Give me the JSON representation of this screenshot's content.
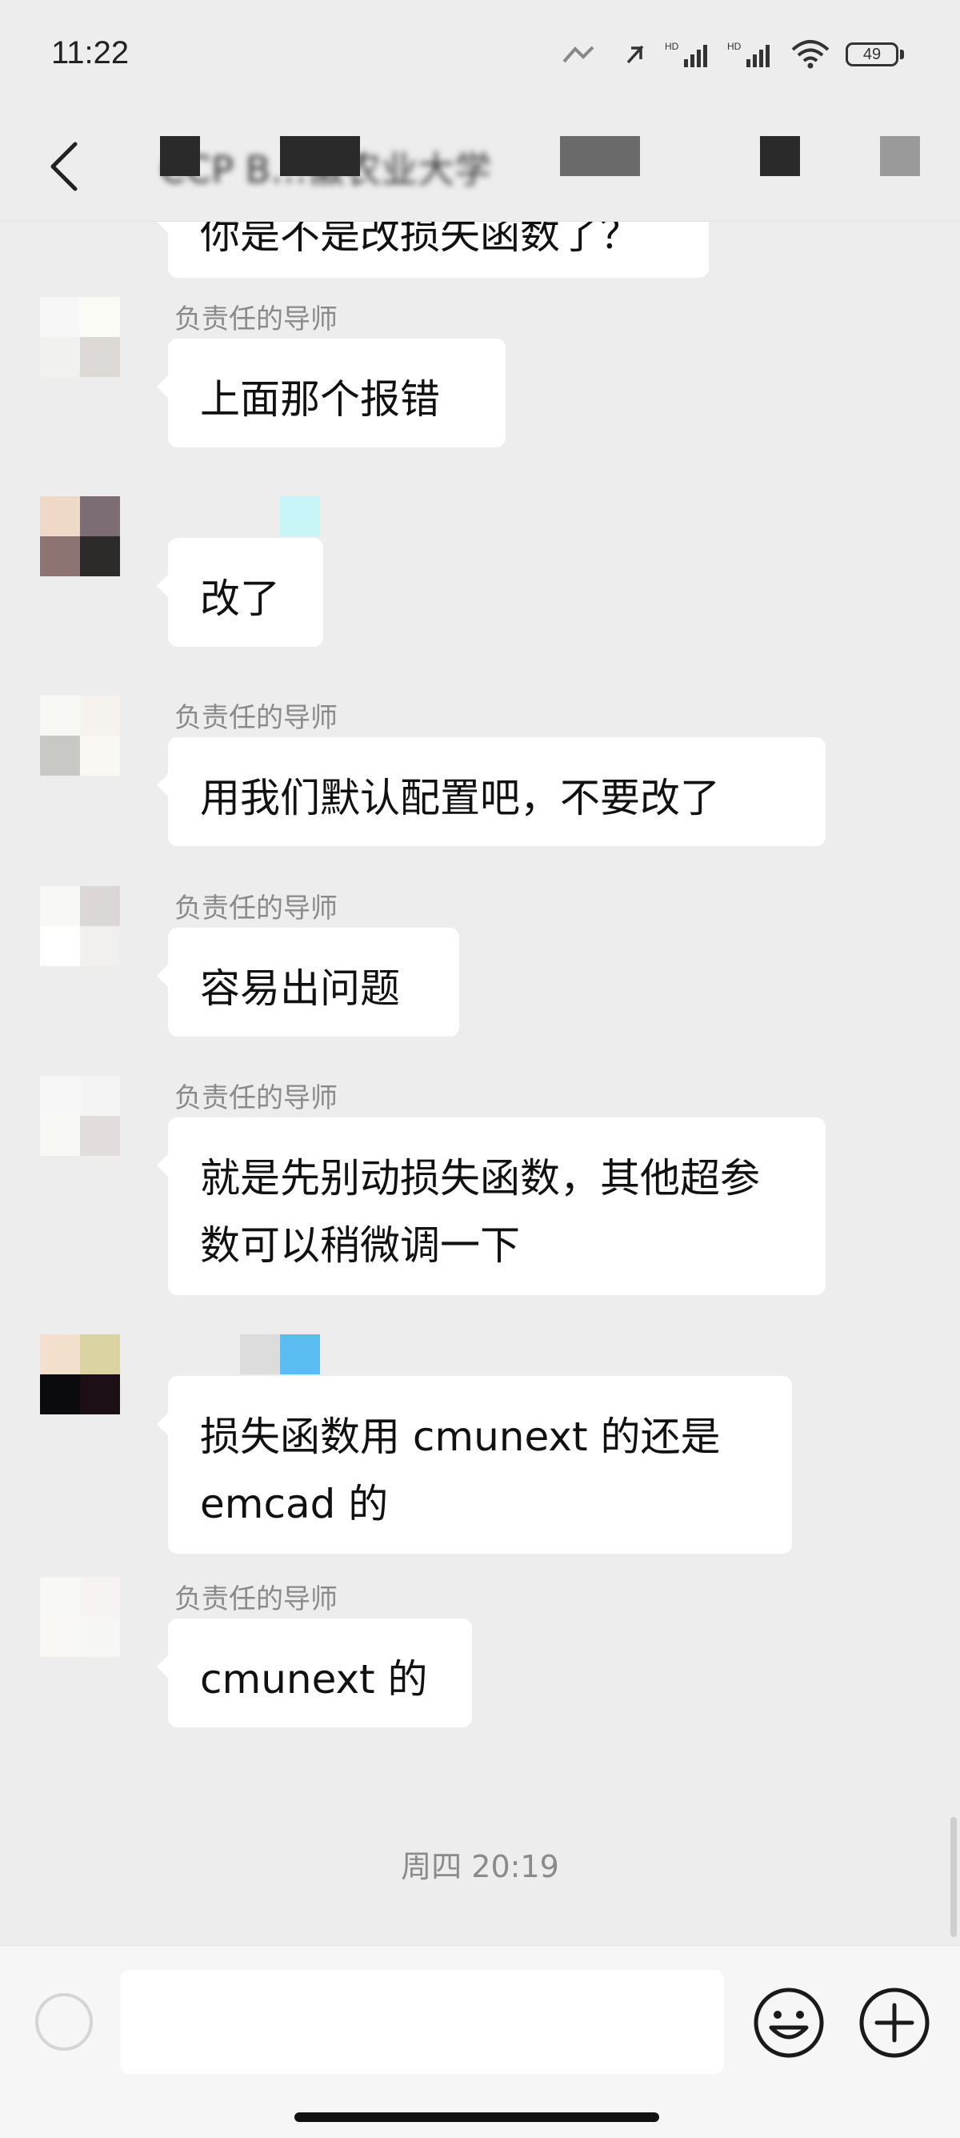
{
  "status_bar": {
    "time": "11:22",
    "battery": "49",
    "network_label_1": "HD",
    "network_label_2": "HD"
  },
  "header": {
    "title": "CCP B…徽农业大学"
  },
  "messages": [
    {
      "sender": "",
      "text": "你是不是改损失函数了？"
    },
    {
      "sender": "负责任的导师",
      "text": "上面那个报错"
    },
    {
      "sender": "",
      "text": "改了"
    },
    {
      "sender": "负责任的导师",
      "text": "用我们默认配置吧，不要改了"
    },
    {
      "sender": "负责任的导师",
      "text": "容易出问题"
    },
    {
      "sender": "负责任的导师",
      "text": "就是先别动损失函数，其他超参数可以稍微调一下"
    },
    {
      "sender": "",
      "text": "损失函数用 cmunext 的还是 emcad 的"
    },
    {
      "sender": "负责任的导师",
      "text": "cmunext 的"
    }
  ],
  "time_divider": "周四 20:19",
  "input": {
    "value": ""
  },
  "colors": {
    "background": "#ededed",
    "bubble": "#ffffff",
    "sender_text": "#8a8a8a"
  },
  "icons": {
    "back": "chevron-left-icon",
    "emoji": "smiley-icon",
    "more": "plus-circle-icon"
  }
}
